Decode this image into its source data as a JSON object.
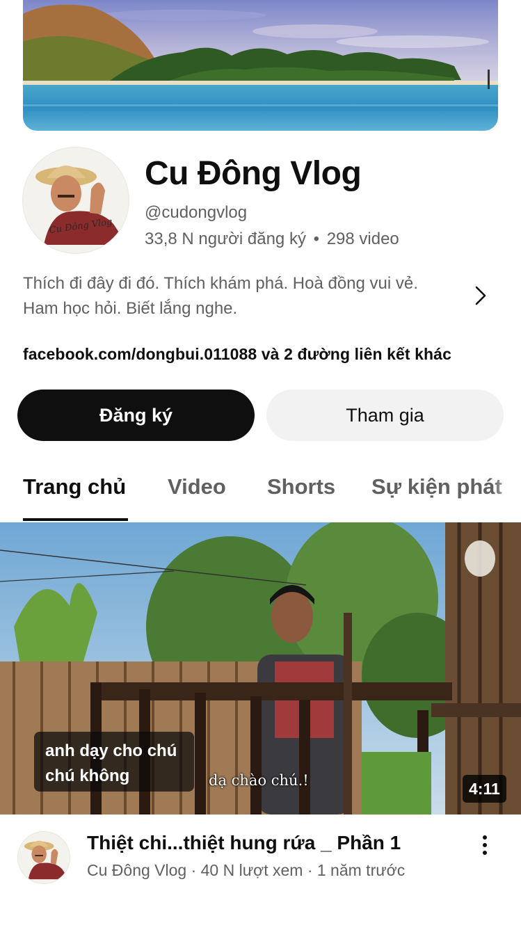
{
  "colors": {
    "text_primary": "#0f0f0f",
    "text_secondary": "#606060",
    "subscribe_bg": "#0f0f0f",
    "join_bg": "#f2f2f2"
  },
  "channel": {
    "name": "Cu Đông Vlog",
    "handle": "@cudongvlog",
    "subscribers": "33,8 N người đăng ký",
    "separator": "•",
    "video_count": "298 video",
    "avatar_label": "Cu Đông Vlog",
    "description_line1": "Thích đi đây đi đó. Thích khám phá. Hoà đồng vui vẻ.",
    "description_line2": "Ham học hỏi. Biết lắng nghe.",
    "links": "facebook.com/dongbui.011088 và 2 đường liên kết khác",
    "banner_icon": "seascape-banner-image",
    "chevron_icon": "chevron-right-icon"
  },
  "actions": {
    "subscribe_label": "Đăng ký",
    "join_label": "Tham gia"
  },
  "tabs": [
    {
      "label": "Trang chủ",
      "active": true
    },
    {
      "label": "Video",
      "active": false
    },
    {
      "label": "Shorts",
      "active": false
    },
    {
      "label": "Sự kiện phát",
      "active": false
    }
  ],
  "featured_video": {
    "caption_line1": "anh dạy cho chú",
    "caption_line2": "chú không",
    "overlay_text": "dạ chào chú.!",
    "duration": "4:11",
    "title": "Thiệt chi...thiệt hung rứa _ Phần 1",
    "meta": "Cu Đông Vlog · 40 N lượt xem · 1 năm trước",
    "more_icon": "more-vertical-icon"
  }
}
